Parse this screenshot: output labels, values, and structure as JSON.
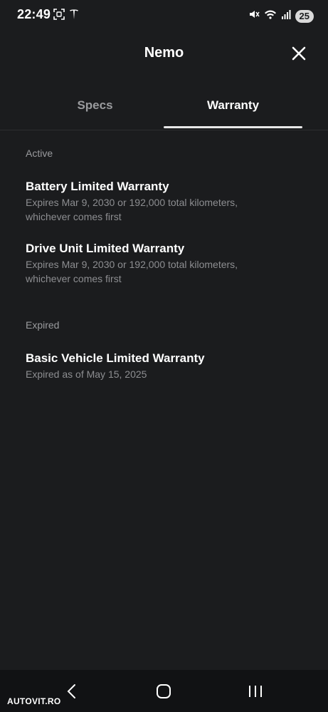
{
  "status_bar": {
    "time": "22:49",
    "battery_level": "25",
    "left_icons": [
      "screenshot-icon",
      "tesla-logo-icon"
    ],
    "right_icons": [
      "mute-icon",
      "wifi-icon",
      "signal-icon"
    ]
  },
  "header": {
    "title": "Nemo",
    "close_icon": "close-icon"
  },
  "tabs": [
    {
      "label": "Specs",
      "selected": false
    },
    {
      "label": "Warranty",
      "selected": true
    }
  ],
  "sections": {
    "active": {
      "label": "Active",
      "items": [
        {
          "title": "Battery Limited Warranty",
          "line1": "Expires Mar 9, 2030 or 192,000 total kilometers,",
          "line2": "whichever comes first"
        },
        {
          "title": "Drive Unit Limited Warranty",
          "line1": "Expires Mar 9, 2030 or 192,000 total kilometers,",
          "line2": "whichever comes first"
        }
      ]
    },
    "expired": {
      "label": "Expired",
      "items": [
        {
          "title": "Basic Vehicle Limited Warranty",
          "line1": "Expired as of May 15, 2025"
        }
      ]
    }
  },
  "navigation": {
    "watermark": "AUTOVIT.RO",
    "buttons": [
      "back-icon",
      "home-icon",
      "recents-icon"
    ]
  },
  "colors": {
    "background": "#1b1c1e",
    "text_primary": "#ffffff",
    "text_secondary": "#9a9b9e",
    "tab_indicator": "#e8e8e8",
    "nav_bar": "#111214"
  }
}
